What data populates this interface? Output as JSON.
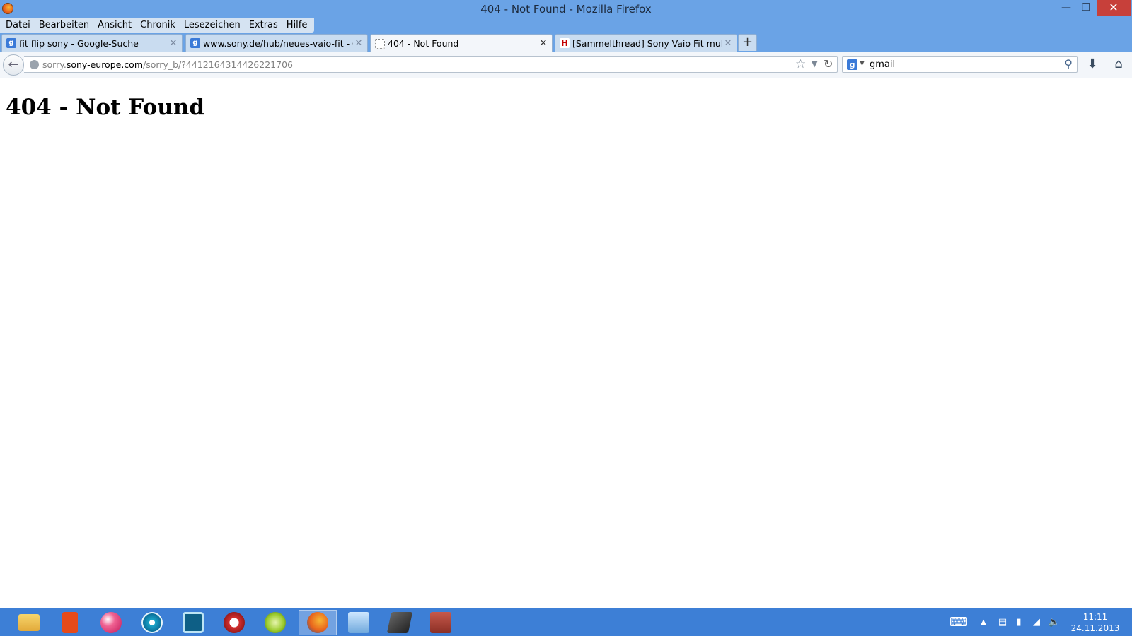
{
  "window": {
    "title": "404 - Not Found - Mozilla Firefox",
    "minimize_icon": "minimize-icon",
    "maximize_icon": "restore-icon",
    "close_icon": "close-icon"
  },
  "menubar": {
    "items": [
      "Datei",
      "Bearbeiten",
      "Ansicht",
      "Chronik",
      "Lesezeichen",
      "Extras",
      "Hilfe"
    ]
  },
  "tabs": [
    {
      "label": "fit flip sony - Google-Suche",
      "favicon": "google-icon",
      "active": false
    },
    {
      "label": "www.sony.de/hub/neues-vaio-fit - Go...",
      "favicon": "google-icon",
      "active": false
    },
    {
      "label": "404 - Not Found",
      "favicon": "blank-page-icon",
      "active": true
    },
    {
      "label": "[Sammelthread] Sony Vaio Fit multi-f...",
      "favicon": "heise-icon",
      "active": false
    }
  ],
  "navbar": {
    "url_prefix": "sorry.",
    "url_host": "sony-europe.com",
    "url_path": "/sorry_b/?4412164314426221706",
    "search_query": "gmail"
  },
  "content": {
    "heading": "404 - Not Found"
  },
  "taskbar": {
    "apps": [
      "file-explorer-icon",
      "office-icon",
      "media-ball-icon",
      "disc-icon",
      "video-icon",
      "audio-recorder-icon",
      "music-icon",
      "firefox-icon",
      "control-panel-icon",
      "tablet-icon",
      "winrar-icon"
    ],
    "active_app": "firefox-icon",
    "time": "11:11",
    "date": "24.11.2013"
  },
  "colors": {
    "titlebar": "#6aa3e6",
    "taskbar": "#3d7fd6",
    "close_button": "#c7403a"
  }
}
